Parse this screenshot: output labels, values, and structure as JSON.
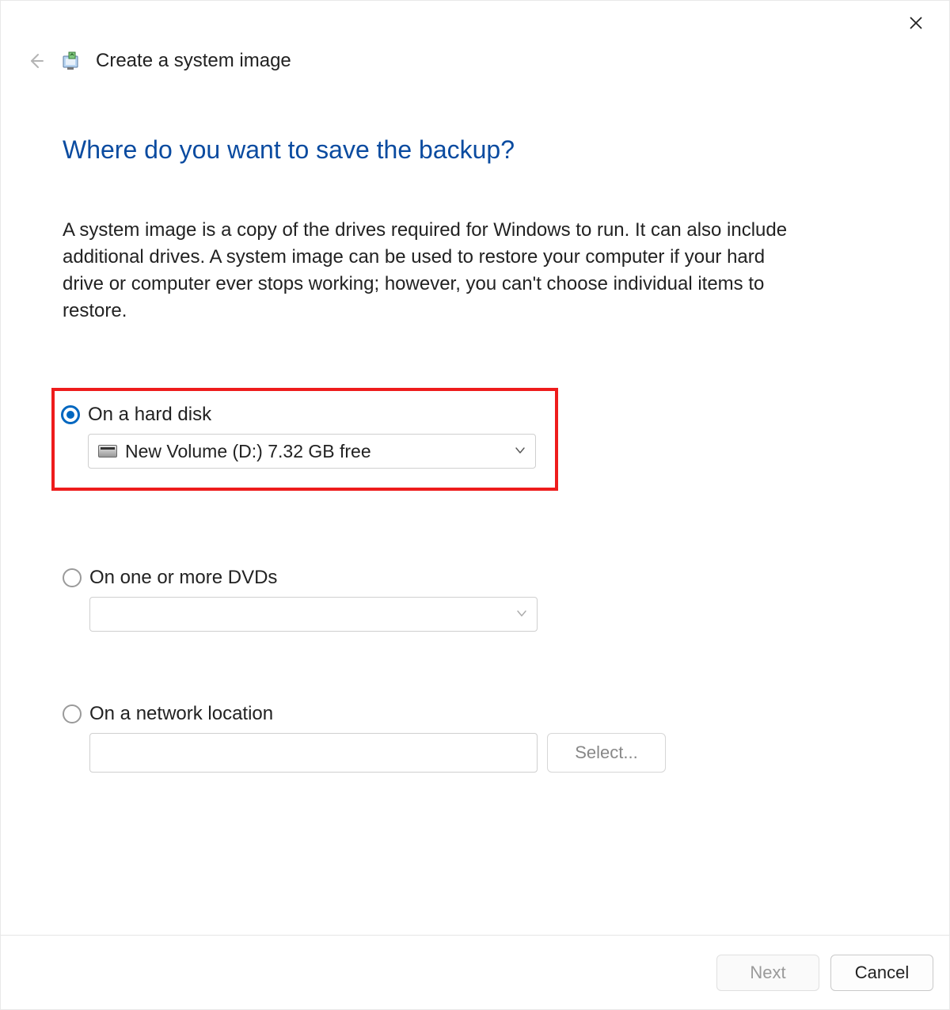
{
  "window": {
    "title": "Create a system image"
  },
  "page": {
    "heading": "Where do you want to save the backup?",
    "description": "A system image is a copy of the drives required for Windows to run. It can also include additional drives. A system image can be used to restore your computer if your hard drive or computer ever stops working; however, you can't choose individual items to restore."
  },
  "options": {
    "hard_disk": {
      "label": "On a hard disk",
      "checked": true,
      "selected_drive": "New Volume (D:)  7.32 GB free"
    },
    "dvd": {
      "label": "On one or more DVDs",
      "checked": false,
      "selected_drive": ""
    },
    "network": {
      "label": "On a network location",
      "checked": false,
      "path": "",
      "select_button": "Select..."
    }
  },
  "footer": {
    "next": "Next",
    "cancel": "Cancel"
  }
}
